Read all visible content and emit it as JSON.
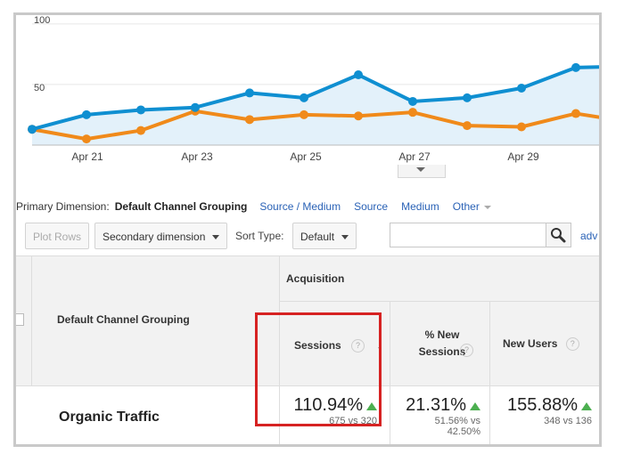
{
  "chart_data": {
    "type": "line",
    "x_ticks": [
      "Apr 21",
      "Apr 23",
      "Apr 25",
      "Apr 27",
      "Apr 29"
    ],
    "y_ticks": [
      "100",
      "50"
    ],
    "ylim": [
      0,
      100
    ],
    "fill_first_series": true,
    "series": [
      {
        "color": "#0f8fd1",
        "values": [
          13,
          25,
          29,
          31,
          43,
          39,
          58,
          36,
          39,
          47,
          64,
          65
        ]
      },
      {
        "color": "#f08a1a",
        "values": [
          13,
          5,
          12,
          28,
          21,
          25,
          24,
          27,
          16,
          15,
          26,
          19
        ]
      }
    ]
  },
  "dimension_bar": {
    "label": "Primary Dimension:",
    "current": "Default Channel Grouping",
    "links": [
      "Source / Medium",
      "Source",
      "Medium",
      "Other"
    ]
  },
  "toolbar": {
    "plot_rows": "Plot Rows",
    "secondary_dimension": "Secondary dimension",
    "sort_type_label": "Sort Type:",
    "sort_type_value": "Default",
    "search_placeholder": "",
    "advanced": "adv",
    "search_icon": "magnifier-icon"
  },
  "table": {
    "dimension_header": "Default Channel Grouping",
    "group_header": "Acquisition",
    "columns": [
      {
        "label": "Sessions",
        "has_sort_arrow": true
      },
      {
        "label": "% New Sessions"
      },
      {
        "label": "New Users"
      }
    ],
    "rows": [
      {
        "name": "Organic Traffic",
        "cells": [
          {
            "value": "110.94%",
            "compare": "675 vs 320"
          },
          {
            "value": "21.31%",
            "compare_1": "51.56% vs",
            "compare_2": "42.50%"
          },
          {
            "value": "155.88%",
            "compare": "348 vs 136"
          }
        ]
      }
    ]
  },
  "colors": {
    "link": "#2a62b6",
    "series_blue": "#0f8fd1",
    "series_orange": "#f08a1a",
    "increase": "#4caf50",
    "highlight": "#d62222"
  }
}
